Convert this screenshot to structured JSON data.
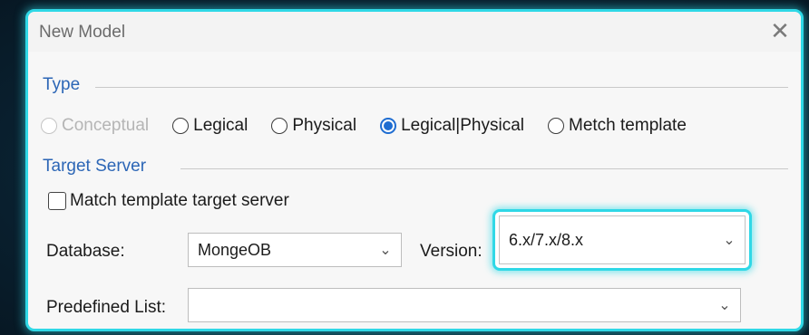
{
  "dialog": {
    "title": "New Model",
    "close_glyph": "✕"
  },
  "type_section": {
    "label": "Type",
    "options": [
      {
        "label": "Conceptual",
        "selected": false,
        "disabled": true
      },
      {
        "label": "Legical",
        "selected": false,
        "disabled": false
      },
      {
        "label": "Physical",
        "selected": false,
        "disabled": false
      },
      {
        "label": "Legical|Physical",
        "selected": true,
        "disabled": false
      },
      {
        "label": "Metch template",
        "selected": false,
        "disabled": false
      }
    ]
  },
  "target_section": {
    "label": "Target Server",
    "match_checkbox_label": "Match template target server",
    "database_label": "Database:",
    "database_value": "MongeOB",
    "version_label": "Version:",
    "version_value": "6.x/7.x/8.x",
    "predefined_label": "Predefined List:",
    "predefined_value": ""
  },
  "colors": {
    "accent": "#2fd8e6",
    "section_label": "#2c66b6",
    "radio_selected": "#1f6dd1"
  },
  "icons": {
    "close": "close-icon",
    "dropdown": "chevron-down-icon"
  }
}
